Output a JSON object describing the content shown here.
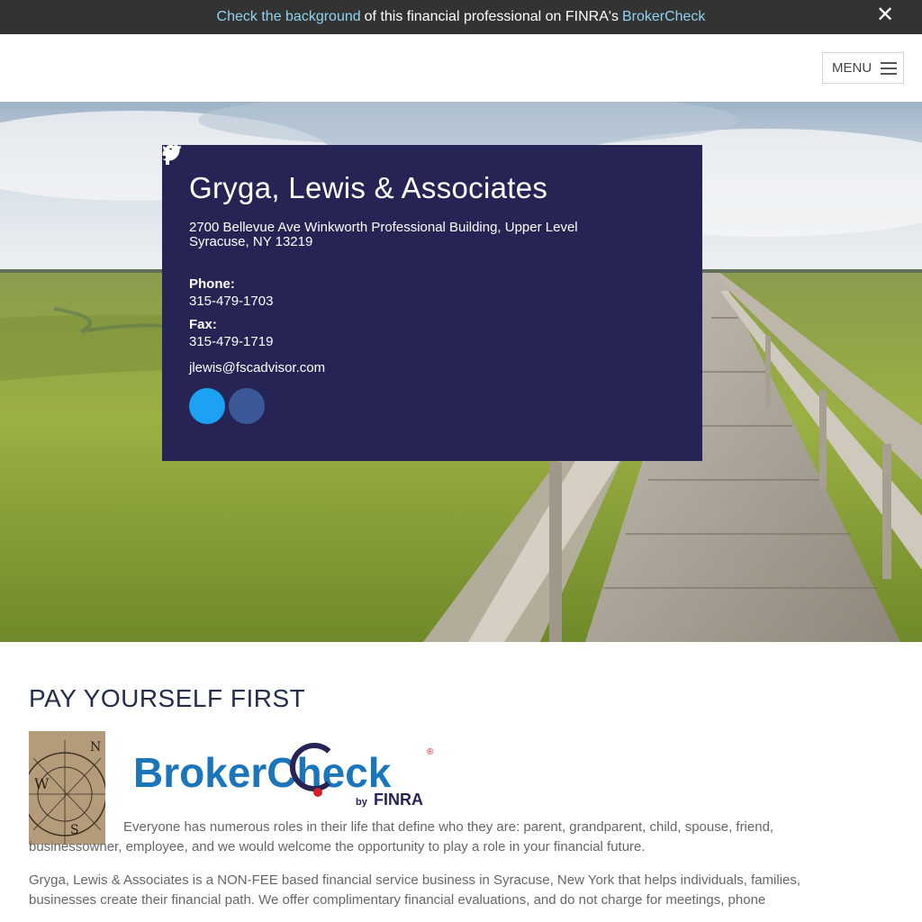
{
  "banner": {
    "link1": "Check the background",
    "middle": "of this financial professional on FINRA's",
    "link2": "BrokerCheck",
    "close": "✕"
  },
  "header": {
    "menu_label": "MENU"
  },
  "card": {
    "title": "Gryga, Lewis & Associates",
    "address_line1": "2700 Bellevue Ave Winkworth Professional Building, Upper Level",
    "address_line2": "Syracuse, NY 13219",
    "phone_label": "Phone:",
    "phone": "315-479-1703",
    "fax_label": "Fax:",
    "fax": "315-479-1719",
    "email": "jlewis@fscadvisor.com"
  },
  "section": {
    "heading": "PAY YOURSELF FIRST",
    "logo_text": "BrokerCheck",
    "logo_by": "by",
    "logo_finra": "FINRA",
    "para1": "Everyone has numerous roles in their life that define who they are: parent, grandparent, child, spouse, friend, businessowner, employee, and we would welcome the opportunity to play a role in your financial future.",
    "para2": "Gryga, Lewis & Associates is a NON-FEE based financial service business in Syracuse, New York that helps individuals, families, businesses create their financial path. We offer complimentary financial evaluations, and do not charge for meetings, phone"
  },
  "colors": {
    "card_bg": "#262455",
    "banner_bg": "#333333",
    "link": "#8fd3f0",
    "brokercheck_blue": "#1a75bb"
  },
  "icons": [
    "close-icon",
    "hamburger-icon",
    "twitter-icon",
    "facebook-icon"
  ]
}
